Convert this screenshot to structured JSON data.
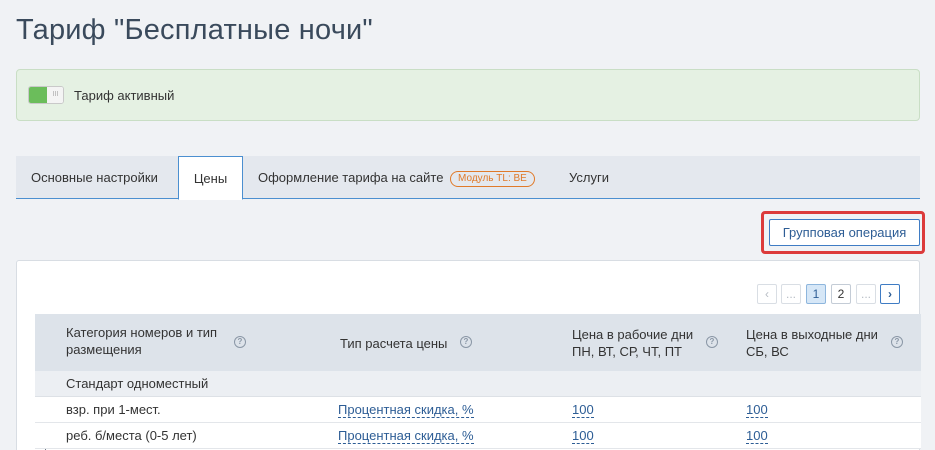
{
  "page": {
    "title": "Тариф \"Бесплатные ночи\""
  },
  "status": {
    "toggle_text": "III",
    "label": "Тариф активный",
    "active": true
  },
  "tabs": [
    {
      "label": "Основные настройки",
      "active": false
    },
    {
      "label": "Цены",
      "active": true
    },
    {
      "label": "Оформление тарифа на сайте",
      "badge": "Модуль TL: BE",
      "active": false
    },
    {
      "label": "Услуги",
      "active": false
    }
  ],
  "toolbar": {
    "group_operation_label": "Групповая операция"
  },
  "pagination": {
    "prev": "‹",
    "ellipsis_left": "...",
    "pages": [
      "1",
      "2"
    ],
    "current": "1",
    "ellipsis_right": "...",
    "next": "›"
  },
  "table": {
    "help_glyph": "?",
    "columns": [
      {
        "label": "Категория номеров и тип размещения"
      },
      {
        "label": "Тип расчета цены"
      },
      {
        "label": "Цена в рабочие дни ПН, ВТ, СР, ЧТ, ПТ"
      },
      {
        "label": "Цена в выходные дни СБ, ВС"
      }
    ],
    "group": "Стандарт одноместный",
    "rows": [
      {
        "name": "взр. при 1-мест.",
        "calc_type": "Процентная скидка, %",
        "weekday_price": "100",
        "weekend_price": "100"
      },
      {
        "name": "реб. б/места (0-5 лет)",
        "calc_type": "Процентная скидка, %",
        "weekday_price": "100",
        "weekend_price": "100"
      }
    ]
  },
  "colors": {
    "accent": "#3f7cc4",
    "highlight": "#dc3b3b",
    "active_green": "#6bbd5b",
    "badge_orange": "#e07a2a"
  }
}
